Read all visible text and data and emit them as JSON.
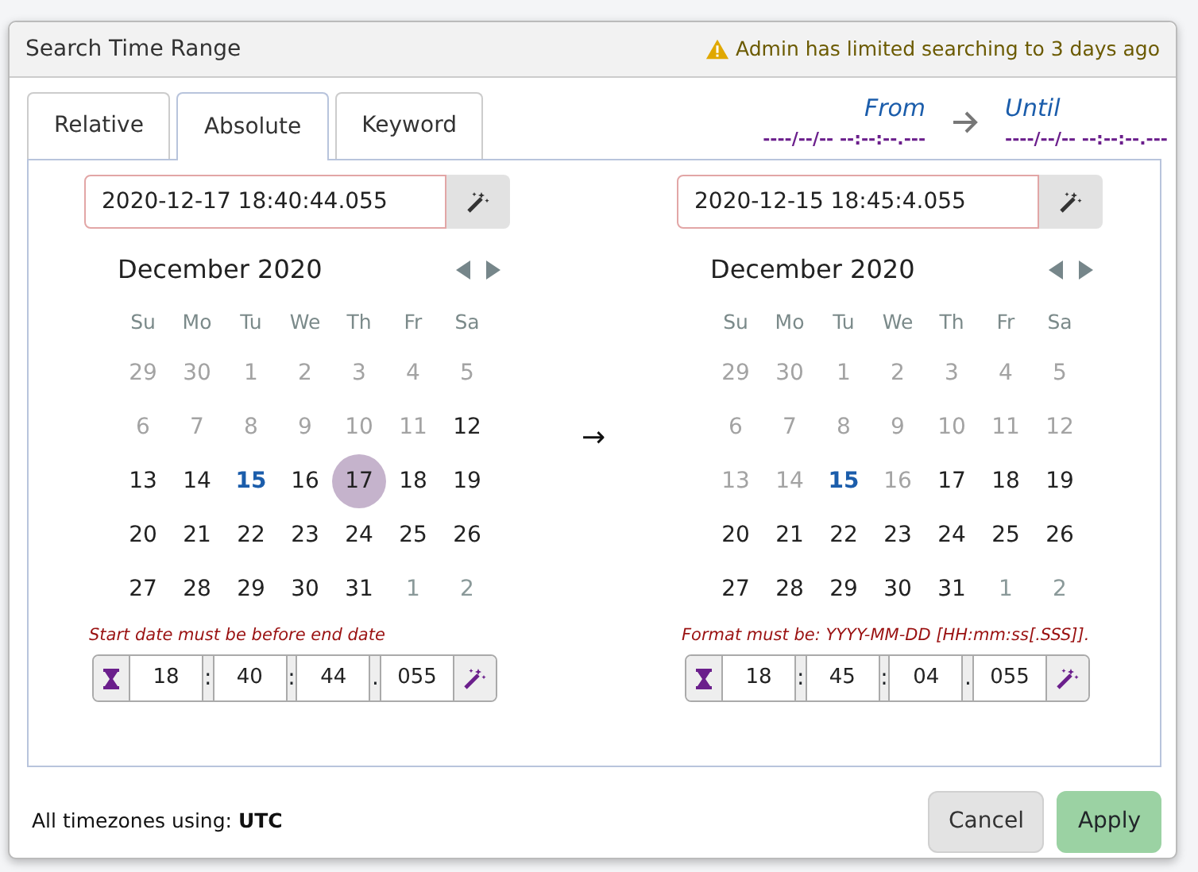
{
  "title": "Search Time Range",
  "warning": "Admin has limited searching to 3 days ago",
  "tabs": [
    {
      "label": "Relative",
      "selected": false
    },
    {
      "label": "Absolute",
      "selected": true
    },
    {
      "label": "Keyword",
      "selected": false
    }
  ],
  "summary": {
    "from_label": "From",
    "from_value": "----/--/-- --:--:--.---",
    "until_label": "Until",
    "until_value": "----/--/-- --:--:--.---"
  },
  "range_arrow": "→",
  "panels": [
    {
      "input": "2020-12-17 18:40:44.055",
      "invalid": true,
      "month": "December 2020",
      "weekdays": [
        "Su",
        "Mo",
        "Tu",
        "We",
        "Th",
        "Fr",
        "Sa"
      ],
      "weeks": [
        [
          {
            "d": "29",
            "kind": "disabled",
            "selected": false
          },
          {
            "d": "30",
            "kind": "disabled",
            "selected": false
          },
          {
            "d": "1",
            "kind": "disabled",
            "selected": false
          },
          {
            "d": "2",
            "kind": "disabled",
            "selected": false
          },
          {
            "d": "3",
            "kind": "disabled",
            "selected": false
          },
          {
            "d": "4",
            "kind": "disabled",
            "selected": false
          },
          {
            "d": "5",
            "kind": "disabled",
            "selected": false
          }
        ],
        [
          {
            "d": "6",
            "kind": "disabled",
            "selected": false
          },
          {
            "d": "7",
            "kind": "disabled",
            "selected": false
          },
          {
            "d": "8",
            "kind": "disabled",
            "selected": false
          },
          {
            "d": "9",
            "kind": "disabled",
            "selected": false
          },
          {
            "d": "10",
            "kind": "disabled",
            "selected": false
          },
          {
            "d": "11",
            "kind": "disabled",
            "selected": false
          },
          {
            "d": "12",
            "kind": "normal",
            "selected": false
          }
        ],
        [
          {
            "d": "13",
            "kind": "normal",
            "selected": false
          },
          {
            "d": "14",
            "kind": "normal",
            "selected": false
          },
          {
            "d": "15",
            "kind": "today",
            "selected": false
          },
          {
            "d": "16",
            "kind": "normal",
            "selected": false
          },
          {
            "d": "17",
            "kind": "normal",
            "selected": true
          },
          {
            "d": "18",
            "kind": "normal",
            "selected": false
          },
          {
            "d": "19",
            "kind": "normal",
            "selected": false
          }
        ],
        [
          {
            "d": "20",
            "kind": "normal",
            "selected": false
          },
          {
            "d": "21",
            "kind": "normal",
            "selected": false
          },
          {
            "d": "22",
            "kind": "normal",
            "selected": false
          },
          {
            "d": "23",
            "kind": "normal",
            "selected": false
          },
          {
            "d": "24",
            "kind": "normal",
            "selected": false
          },
          {
            "d": "25",
            "kind": "normal",
            "selected": false
          },
          {
            "d": "26",
            "kind": "normal",
            "selected": false
          }
        ],
        [
          {
            "d": "27",
            "kind": "normal",
            "selected": false
          },
          {
            "d": "28",
            "kind": "normal",
            "selected": false
          },
          {
            "d": "29",
            "kind": "normal",
            "selected": false
          },
          {
            "d": "30",
            "kind": "normal",
            "selected": false
          },
          {
            "d": "31",
            "kind": "normal",
            "selected": false
          },
          {
            "d": "1",
            "kind": "outside",
            "selected": false
          },
          {
            "d": "2",
            "kind": "outside",
            "selected": false
          }
        ]
      ],
      "error": "Start date must be before end date",
      "time": {
        "hours": "18",
        "minutes": "40",
        "seconds": "44",
        "millis": "055",
        "sep1": ":",
        "sep2": ":",
        "sep3": "."
      }
    },
    {
      "input": "2020-12-15 18:45:4.055",
      "invalid": true,
      "month": "December 2020",
      "weekdays": [
        "Su",
        "Mo",
        "Tu",
        "We",
        "Th",
        "Fr",
        "Sa"
      ],
      "weeks": [
        [
          {
            "d": "29",
            "kind": "disabled",
            "selected": false
          },
          {
            "d": "30",
            "kind": "disabled",
            "selected": false
          },
          {
            "d": "1",
            "kind": "disabled",
            "selected": false
          },
          {
            "d": "2",
            "kind": "disabled",
            "selected": false
          },
          {
            "d": "3",
            "kind": "disabled",
            "selected": false
          },
          {
            "d": "4",
            "kind": "disabled",
            "selected": false
          },
          {
            "d": "5",
            "kind": "disabled",
            "selected": false
          }
        ],
        [
          {
            "d": "6",
            "kind": "disabled",
            "selected": false
          },
          {
            "d": "7",
            "kind": "disabled",
            "selected": false
          },
          {
            "d": "8",
            "kind": "disabled",
            "selected": false
          },
          {
            "d": "9",
            "kind": "disabled",
            "selected": false
          },
          {
            "d": "10",
            "kind": "disabled",
            "selected": false
          },
          {
            "d": "11",
            "kind": "disabled",
            "selected": false
          },
          {
            "d": "12",
            "kind": "disabled",
            "selected": false
          }
        ],
        [
          {
            "d": "13",
            "kind": "disabled",
            "selected": false
          },
          {
            "d": "14",
            "kind": "disabled",
            "selected": false
          },
          {
            "d": "15",
            "kind": "today",
            "selected": false
          },
          {
            "d": "16",
            "kind": "disabled",
            "selected": false
          },
          {
            "d": "17",
            "kind": "normal",
            "selected": false
          },
          {
            "d": "18",
            "kind": "normal",
            "selected": false
          },
          {
            "d": "19",
            "kind": "normal",
            "selected": false
          }
        ],
        [
          {
            "d": "20",
            "kind": "normal",
            "selected": false
          },
          {
            "d": "21",
            "kind": "normal",
            "selected": false
          },
          {
            "d": "22",
            "kind": "normal",
            "selected": false
          },
          {
            "d": "23",
            "kind": "normal",
            "selected": false
          },
          {
            "d": "24",
            "kind": "normal",
            "selected": false
          },
          {
            "d": "25",
            "kind": "normal",
            "selected": false
          },
          {
            "d": "26",
            "kind": "normal",
            "selected": false
          }
        ],
        [
          {
            "d": "27",
            "kind": "normal",
            "selected": false
          },
          {
            "d": "28",
            "kind": "normal",
            "selected": false
          },
          {
            "d": "29",
            "kind": "normal",
            "selected": false
          },
          {
            "d": "30",
            "kind": "normal",
            "selected": false
          },
          {
            "d": "31",
            "kind": "normal",
            "selected": false
          },
          {
            "d": "1",
            "kind": "outside",
            "selected": false
          },
          {
            "d": "2",
            "kind": "outside",
            "selected": false
          }
        ]
      ],
      "error": "Format must be: YYYY-MM-DD [HH:mm:ss[.SSS]].",
      "time": {
        "hours": "18",
        "minutes": "45",
        "seconds": "04",
        "millis": "055",
        "sep1": ":",
        "sep2": ":",
        "sep3": "."
      }
    }
  ],
  "timezone_note": "All timezones using: **UTC**",
  "buttons": [
    {
      "label": "Cancel",
      "kind": "secondary",
      "disabled": false
    },
    {
      "label": "Apply",
      "kind": "primary",
      "disabled": true
    }
  ]
}
